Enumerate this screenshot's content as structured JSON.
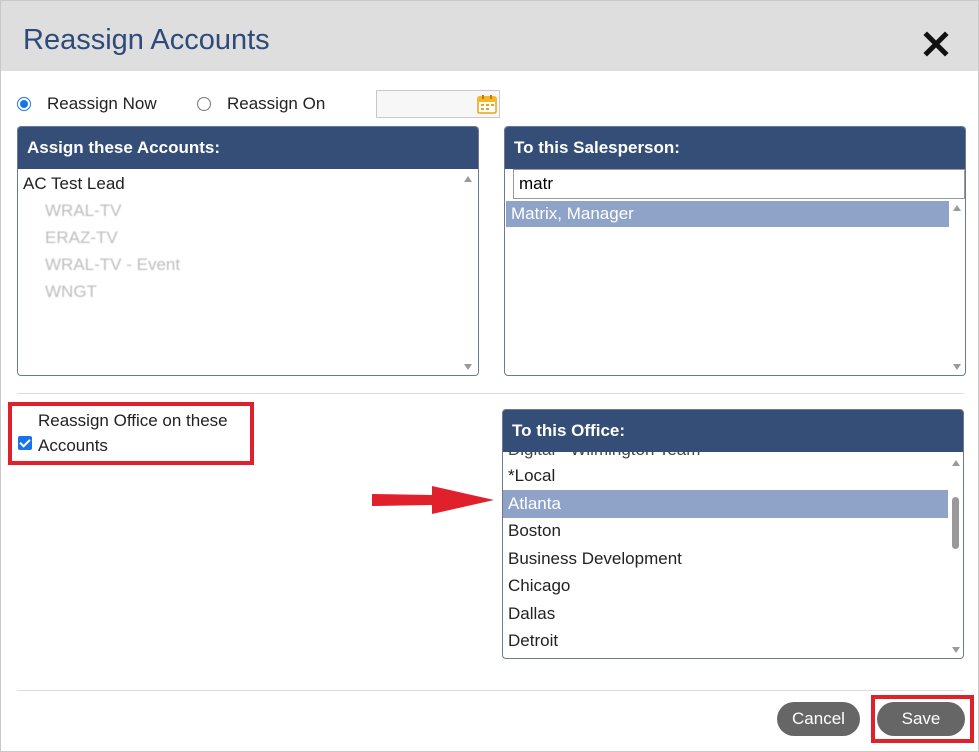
{
  "dialog": {
    "title": "Reassign Accounts",
    "close_icon": "close-x-icon"
  },
  "schedule": {
    "now_label": "Reassign Now",
    "on_label": "Reassign On",
    "selected": "now",
    "date_value": "",
    "calendar_icon": "calendar-icon"
  },
  "accounts_panel": {
    "header": "Assign these Accounts:",
    "items": [
      "AC Test Lead",
      "WRAL-TV",
      "ERAZ-TV",
      "WRAL-TV - Event",
      "WNGT"
    ]
  },
  "salesperson_panel": {
    "header": "To this Salesperson:",
    "search_value": "matr",
    "items": [
      "Matrix, Manager"
    ],
    "selected": "Matrix, Manager"
  },
  "office_option": {
    "label_line1": "Reassign Office on these",
    "label_line2": "Accounts",
    "checked": true
  },
  "office_panel": {
    "header": "To this Office:",
    "items": [
      "Digital - Wilmington Team",
      "*Local",
      "Atlanta",
      "Boston",
      "Business Development",
      "Chicago",
      "Dallas",
      "Detroit"
    ],
    "selected": "Atlanta"
  },
  "footer": {
    "cancel_label": "Cancel",
    "save_label": "Save"
  },
  "colors": {
    "header_bg": "#354e78",
    "selection_bg": "#8fa3c9",
    "annotation_red": "#e0202a",
    "title_color": "#2e4a7a"
  }
}
